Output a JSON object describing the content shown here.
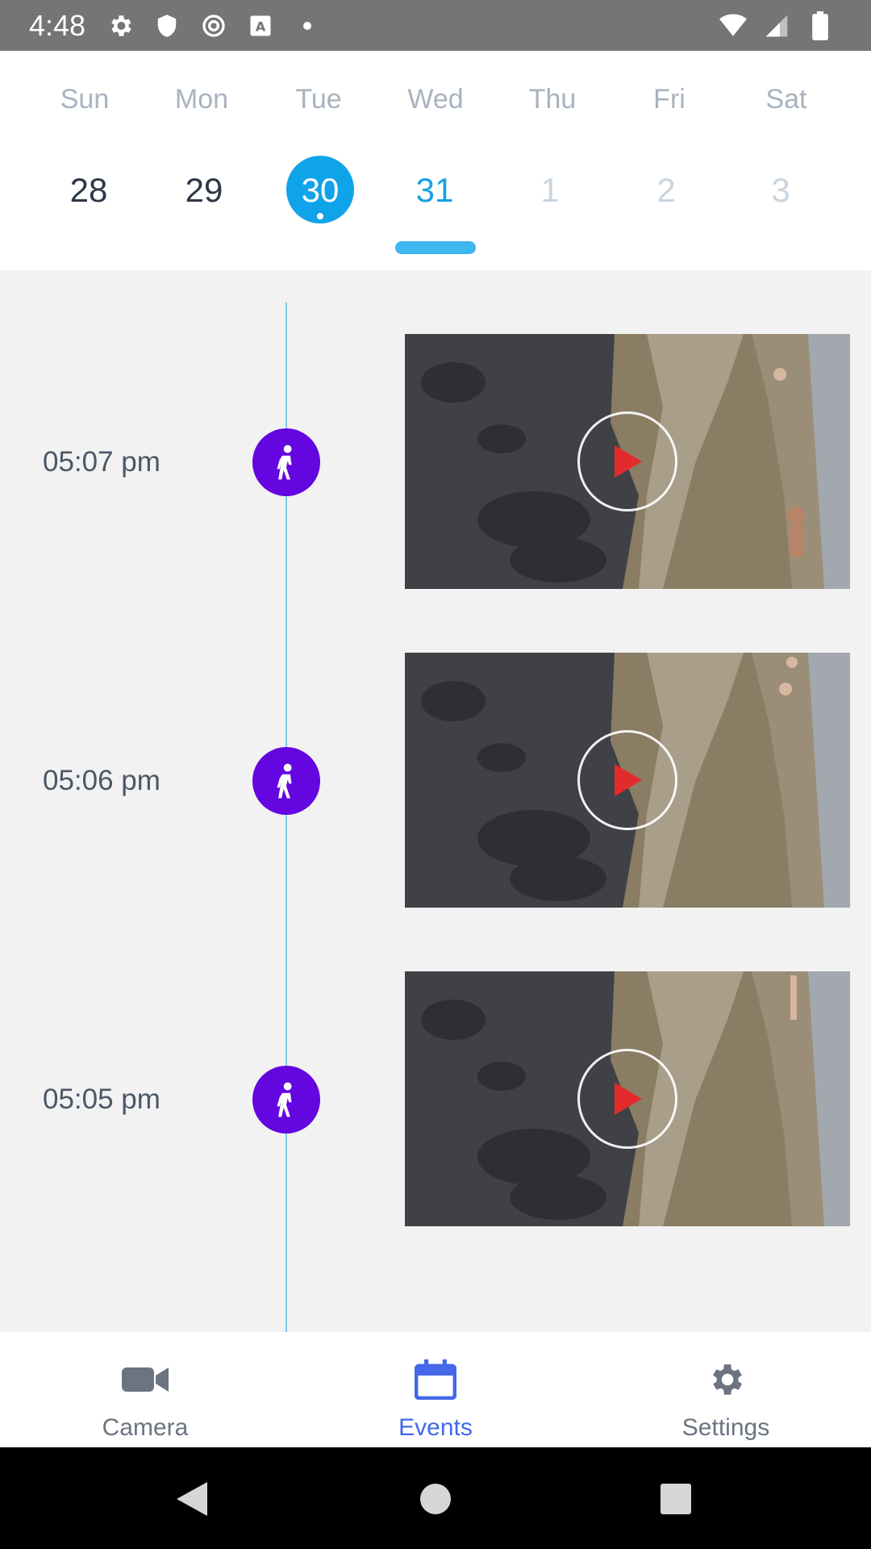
{
  "status_bar": {
    "time": "4:48",
    "icons_left": [
      "gear-icon",
      "shield-icon",
      "sync-icon",
      "font-icon",
      "dot-icon"
    ],
    "icons_right": [
      "wifi-icon",
      "signal-icon",
      "battery-icon"
    ]
  },
  "calendar": {
    "days": [
      "Sun",
      "Mon",
      "Tue",
      "Wed",
      "Thu",
      "Fri",
      "Sat"
    ],
    "dates": [
      "28",
      "29",
      "30",
      "31",
      "1",
      "2",
      "3"
    ],
    "selected_date": "30",
    "today_date": "31",
    "colors": {
      "selected": "#0fa3ea",
      "today": "#16a2e4",
      "indicator": "#3fb6ee"
    }
  },
  "events": [
    {
      "time": "05:07 pm",
      "type": "person-motion"
    },
    {
      "time": "05:06 pm",
      "type": "person-motion"
    },
    {
      "time": "05:05 pm",
      "type": "person-motion"
    }
  ],
  "event_badge_color": "#6306e0",
  "bottom_nav": {
    "items": [
      {
        "label": "Camera",
        "icon": "video-camera-icon",
        "active": false
      },
      {
        "label": "Events",
        "icon": "calendar-icon",
        "active": true
      },
      {
        "label": "Settings",
        "icon": "gear-icon",
        "active": false
      }
    ],
    "active_color": "#4468e8"
  },
  "system_nav": [
    "back-icon",
    "home-icon",
    "recents-icon"
  ]
}
